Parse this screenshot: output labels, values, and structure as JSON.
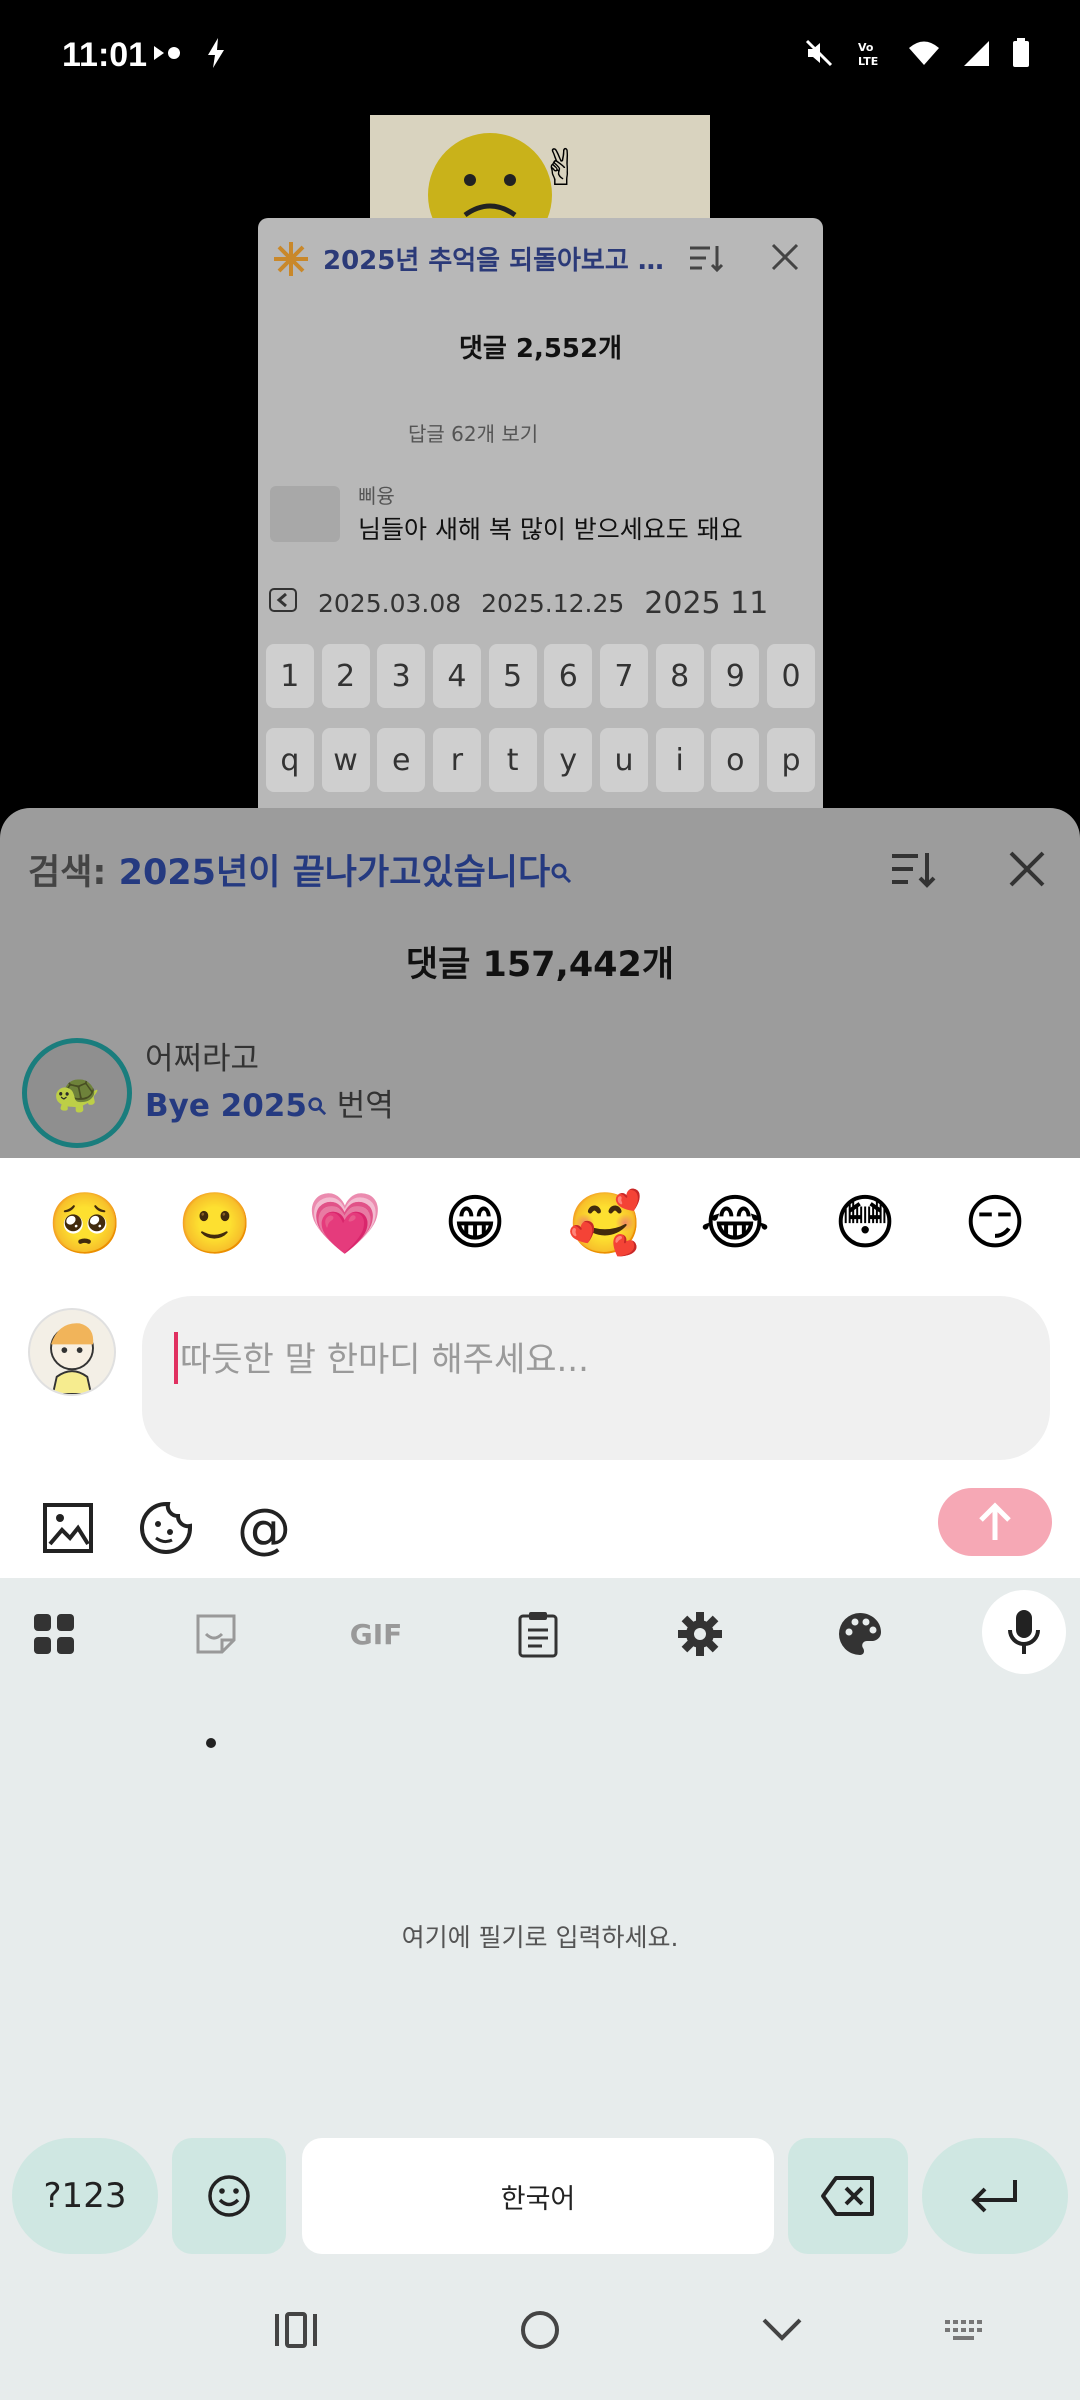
{
  "status_bar": {
    "time": "11:01"
  },
  "background": {
    "card_title": "2025년 추억을 되돌아보고 프로...",
    "card_count": "댓글 2,552개",
    "card_replies": "답글 62개 보기",
    "card_user": "삐융",
    "card_comment": "님들아 새해 복 많이 받으세요도 돼요",
    "suggestions": [
      "2025.03.08",
      "2025.12.25",
      "2025 11"
    ],
    "number_row": [
      "1",
      "2",
      "3",
      "4",
      "5",
      "6",
      "7",
      "8",
      "9",
      "0"
    ],
    "letter_row": [
      "q",
      "w",
      "e",
      "r",
      "t",
      "y",
      "u",
      "i",
      "o",
      "p"
    ]
  },
  "comments_sheet": {
    "search_label": "검색: ",
    "search_query": "2025년이 끝나가고있습니다",
    "count": "댓글 157,442개",
    "top_comment": {
      "user": "어쩌라고",
      "link": "Bye 2025",
      "translate": " 번역"
    }
  },
  "composer": {
    "emojis": [
      "🥺",
      "🙂",
      "💗",
      "😁",
      "🥰",
      "😂",
      "😳",
      "😏"
    ],
    "placeholder": "따듯한 말 한마디 해주세요...",
    "at_symbol": "@"
  },
  "keyboard": {
    "toolbar": {
      "gif": "GIF"
    },
    "handwriting_hint": "여기에 필기로 입력하세요.",
    "symbols_key": "?123",
    "space_key": "한국어"
  },
  "colors": {
    "accent_link": "#253a80",
    "send_button": "#f6a8b5",
    "caret": "#e03060",
    "keyboard_bg": "#e7ecec",
    "key_teal": "#cfe7e2"
  }
}
